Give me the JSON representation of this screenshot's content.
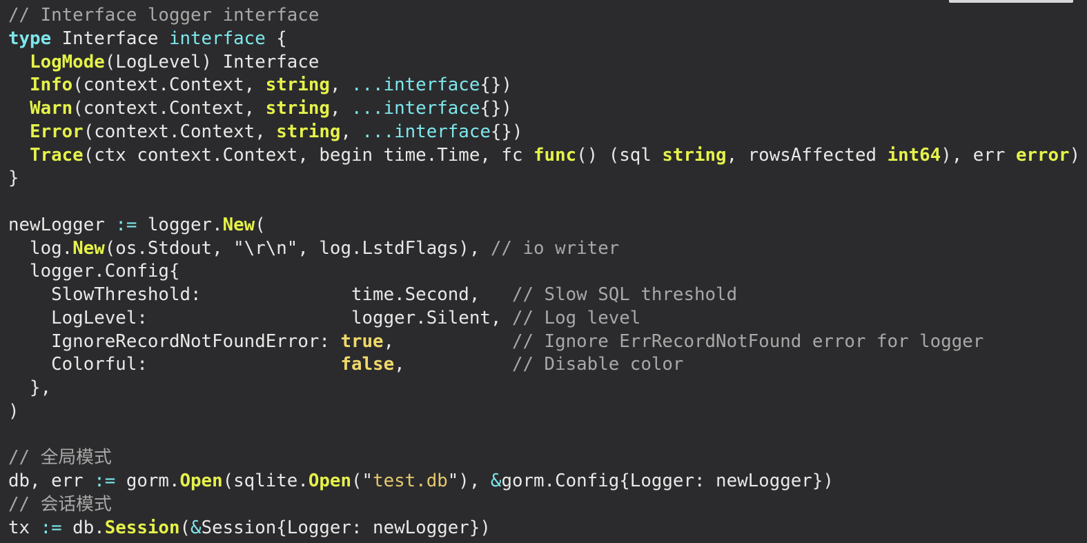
{
  "lines": [
    [
      {
        "t": "// Interface logger interface",
        "c": "c"
      }
    ],
    [
      {
        "t": "type",
        "c": "k"
      },
      {
        "t": " Interface "
      },
      {
        "t": "interface",
        "c": "t"
      },
      {
        "t": " {"
      }
    ],
    [
      {
        "t": "  "
      },
      {
        "t": "LogMode",
        "c": "f"
      },
      {
        "t": "(LogLevel) Interface"
      }
    ],
    [
      {
        "t": "  "
      },
      {
        "t": "Info",
        "c": "f"
      },
      {
        "t": "(context.Context, "
      },
      {
        "t": "string",
        "c": "b"
      },
      {
        "t": ", "
      },
      {
        "t": "...interface",
        "c": "t"
      },
      {
        "t": "{})"
      }
    ],
    [
      {
        "t": "  "
      },
      {
        "t": "Warn",
        "c": "f"
      },
      {
        "t": "(context.Context, "
      },
      {
        "t": "string",
        "c": "b"
      },
      {
        "t": ", "
      },
      {
        "t": "...interface",
        "c": "t"
      },
      {
        "t": "{})"
      }
    ],
    [
      {
        "t": "  "
      },
      {
        "t": "Error",
        "c": "f"
      },
      {
        "t": "(context.Context, "
      },
      {
        "t": "string",
        "c": "b"
      },
      {
        "t": ", "
      },
      {
        "t": "...interface",
        "c": "t"
      },
      {
        "t": "{})"
      }
    ],
    [
      {
        "t": "  "
      },
      {
        "t": "Trace",
        "c": "f"
      },
      {
        "t": "(ctx context.Context, begin time.Time, fc "
      },
      {
        "t": "func",
        "c": "f"
      },
      {
        "t": "() (sql "
      },
      {
        "t": "string",
        "c": "b"
      },
      {
        "t": ", rowsAffected "
      },
      {
        "t": "int64",
        "c": "b"
      },
      {
        "t": "), err "
      },
      {
        "t": "error",
        "c": "b"
      },
      {
        "t": ")"
      }
    ],
    [
      {
        "t": "}"
      }
    ],
    [
      {
        "t": ""
      }
    ],
    [
      {
        "t": "newLogger "
      },
      {
        "t": ":=",
        "c": "o"
      },
      {
        "t": " logger."
      },
      {
        "t": "New",
        "c": "f"
      },
      {
        "t": "("
      }
    ],
    [
      {
        "t": "  log."
      },
      {
        "t": "New",
        "c": "f"
      },
      {
        "t": "(os.Stdout, \"\\r\\n\", log.LstdFlags), "
      },
      {
        "t": "// io writer",
        "c": "c"
      }
    ],
    [
      {
        "t": "  logger.Config{"
      }
    ],
    [
      {
        "t": "    SlowThreshold:              time.Second,   "
      },
      {
        "t": "// Slow SQL threshold",
        "c": "c"
      }
    ],
    [
      {
        "t": "    LogLevel:                   logger.Silent, "
      },
      {
        "t": "// Log level",
        "c": "c"
      }
    ],
    [
      {
        "t": "    IgnoreRecordNotFoundError: "
      },
      {
        "t": "true",
        "c": "v"
      },
      {
        "t": ",           "
      },
      {
        "t": "// Ignore ErrRecordNotFound error for logger",
        "c": "c"
      }
    ],
    [
      {
        "t": "    Colorful:                  "
      },
      {
        "t": "false",
        "c": "v"
      },
      {
        "t": ",          "
      },
      {
        "t": "// Disable color",
        "c": "c"
      }
    ],
    [
      {
        "t": "  },"
      }
    ],
    [
      {
        "t": ")"
      }
    ],
    [
      {
        "t": ""
      }
    ],
    [
      {
        "t": "// 全局模式",
        "c": "c"
      }
    ],
    [
      {
        "t": "db, err "
      },
      {
        "t": ":=",
        "c": "o"
      },
      {
        "t": " gorm."
      },
      {
        "t": "Open",
        "c": "f"
      },
      {
        "t": "(sqlite."
      },
      {
        "t": "Open",
        "c": "f"
      },
      {
        "t": "(\""
      },
      {
        "t": "test.db",
        "c": "s"
      },
      {
        "t": "\"), "
      },
      {
        "t": "&",
        "c": "o"
      },
      {
        "t": "gorm.Config{Logger: newLogger})"
      }
    ],
    [
      {
        "t": "// 会话模式",
        "c": "c"
      }
    ],
    [
      {
        "t": "tx "
      },
      {
        "t": ":=",
        "c": "o"
      },
      {
        "t": " db."
      },
      {
        "t": "Session",
        "c": "f"
      },
      {
        "t": "("
      },
      {
        "t": "&",
        "c": "o"
      },
      {
        "t": "Session{Logger: newLogger})"
      }
    ]
  ]
}
